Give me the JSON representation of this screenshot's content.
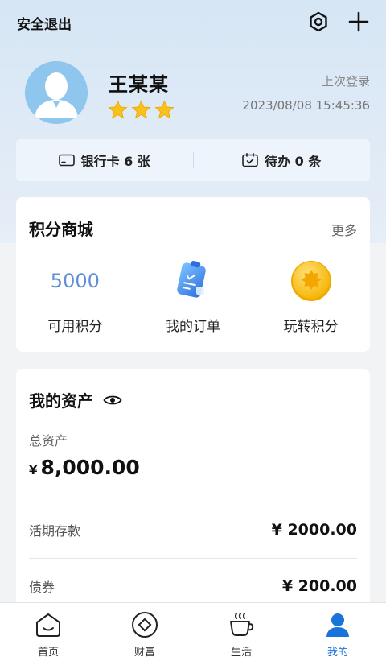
{
  "header": {
    "logout_label": "安全退出",
    "settings_icon": "settings-icon",
    "add_icon": "plus-icon"
  },
  "user": {
    "name": "王某某",
    "stars": 3,
    "last_login_label": "上次登录",
    "last_login_time": "2023/08/08 15:45:36"
  },
  "stats": {
    "bank_card": "银行卡 6 张",
    "todo": "待办 0 条"
  },
  "points_mall": {
    "title": "积分商城",
    "more": "更多",
    "available_points_value": "5000",
    "available_points_label": "可用积分",
    "orders_label": "我的订单",
    "play_points_label": "玩转积分"
  },
  "assets": {
    "title": "我的资产",
    "total_label": "总资产",
    "currency": "¥",
    "total_value": "8,000.00",
    "rows": [
      {
        "label": "活期存款",
        "value": "¥ 2000.00"
      },
      {
        "label": "债券",
        "value": "¥ 200.00"
      }
    ]
  },
  "tabbar": {
    "tabs": [
      {
        "label": "首页",
        "icon": "home-icon"
      },
      {
        "label": "财富",
        "icon": "wealth-icon"
      },
      {
        "label": "生活",
        "icon": "coffee-icon"
      },
      {
        "label": "我的",
        "icon": "user-icon",
        "active": true
      }
    ]
  },
  "colors": {
    "accent": "#1a73d9",
    "points": "#5f8fd6",
    "star": "#f7c21b"
  }
}
